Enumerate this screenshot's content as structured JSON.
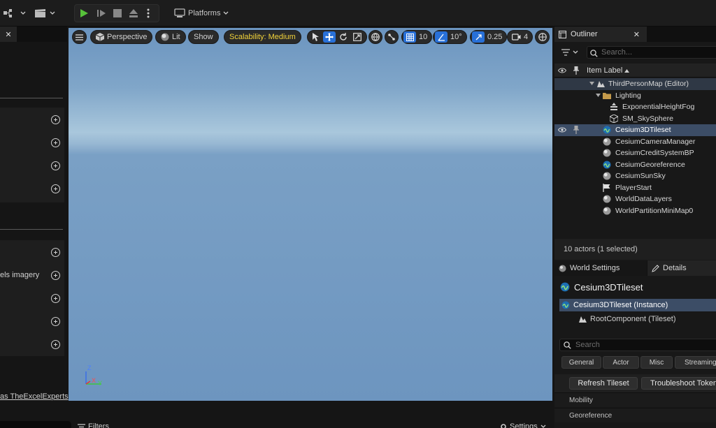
{
  "toolbar": {
    "platforms_label": "Platforms"
  },
  "left_panel": {
    "tab_close": "✕",
    "imagery_label": "els imagery",
    "bottom_link": "as TheExcelExperts"
  },
  "viewport": {
    "perspective_label": "Perspective",
    "lit_label": "Lit",
    "show_label": "Show",
    "scalability_label": "Scalability: Medium",
    "grid_snap_value": "10",
    "rotation_snap_value": "10°",
    "scale_snap_value": "0.25",
    "camera_speed_value": "4",
    "axis_z": "Z",
    "axis_x": "X",
    "axis_y": "Y"
  },
  "outliner": {
    "title": "Outliner",
    "close": "✕",
    "search_placeholder": "Search...",
    "column_label": "Item Label",
    "items": [
      {
        "label": "ThirdPersonMap (Editor)"
      },
      {
        "label": "Lighting"
      },
      {
        "label": "ExponentialHeightFog"
      },
      {
        "label": "SM_SkySphere"
      },
      {
        "label": "Cesium3DTileset"
      },
      {
        "label": "CesiumCameraManager"
      },
      {
        "label": "CesiumCreditSystemBP"
      },
      {
        "label": "CesiumGeoreference"
      },
      {
        "label": "CesiumSunSky"
      },
      {
        "label": "PlayerStart"
      },
      {
        "label": "WorldDataLayers"
      },
      {
        "label": "WorldPartitionMiniMap0"
      }
    ],
    "status": "10 actors (1 selected)"
  },
  "details": {
    "world_settings_tab": "World Settings",
    "details_tab": "Details",
    "actor_title": "Cesium3DTileset",
    "instance_label": "Cesium3DTileset (Instance)",
    "root_component_label": "RootComponent (Tileset)",
    "search_placeholder": "Search",
    "categories": [
      "General",
      "Actor",
      "Misc",
      "Streaming"
    ],
    "refresh_button": "Refresh Tileset",
    "troubleshoot_button": "Troubleshoot Token",
    "sections": [
      "Mobility",
      "Georeference"
    ]
  },
  "bottom": {
    "filters_label": "Filters",
    "settings_label": "Settings"
  },
  "colors": {
    "accent_blue": "#2870d8",
    "play_green": "#57c13a",
    "selection": "#3c4d66",
    "scalability_text": "#f2d33a"
  }
}
